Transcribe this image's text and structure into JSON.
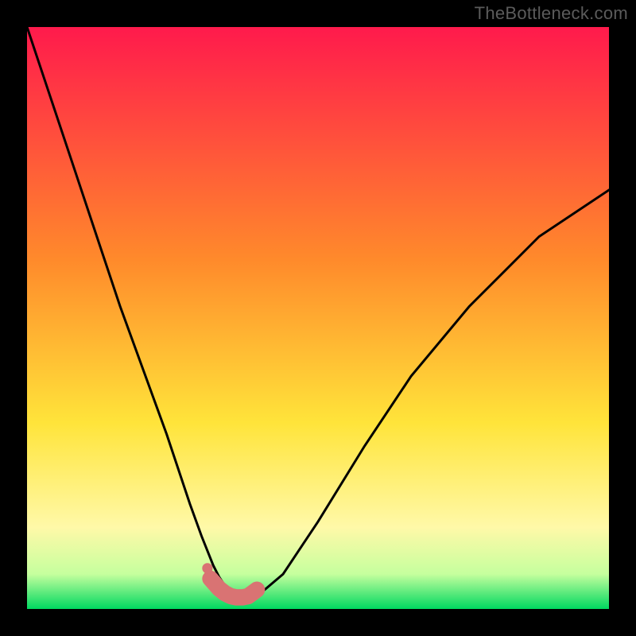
{
  "watermark": "TheBottleneck.com",
  "colors": {
    "frame": "#000000",
    "grad_top": "#ff1a4c",
    "grad_mid1": "#ff8a2b",
    "grad_mid2": "#ffe43a",
    "grad_low1": "#fff9a8",
    "grad_low2": "#c6ff9e",
    "grad_bottom": "#00d860",
    "curve": "#000000",
    "marker_fill": "#d97373",
    "marker_stroke": "#c85a5a"
  },
  "chart_data": {
    "type": "line",
    "title": "",
    "xlabel": "",
    "ylabel": "",
    "xlim": [
      0,
      100
    ],
    "ylim": [
      0,
      100
    ],
    "series": [
      {
        "name": "bottleneck-curve",
        "x": [
          0,
          4,
          8,
          12,
          16,
          20,
          24,
          28,
          30,
          32,
          33,
          34,
          35,
          36,
          37,
          38,
          39,
          40,
          44,
          50,
          58,
          66,
          76,
          88,
          100
        ],
        "y": [
          100,
          88,
          76,
          64,
          52,
          41,
          30,
          18,
          12.5,
          7.5,
          5.5,
          4,
          3,
          2.3,
          2,
          2,
          2.2,
          2.6,
          6,
          15,
          28,
          40,
          52,
          64,
          72
        ]
      }
    ],
    "markers": {
      "name": "highlighted-flat-region",
      "x": [
        31.5,
        33,
        34,
        35,
        36,
        37,
        38,
        39.5
      ],
      "y": [
        5.2,
        3.5,
        2.7,
        2.2,
        2.0,
        2.0,
        2.2,
        3.3
      ]
    },
    "marker_radius_pct": 1.4,
    "end_dot": {
      "x": 31.0,
      "y": 7.0,
      "r_pct": 0.9
    }
  }
}
